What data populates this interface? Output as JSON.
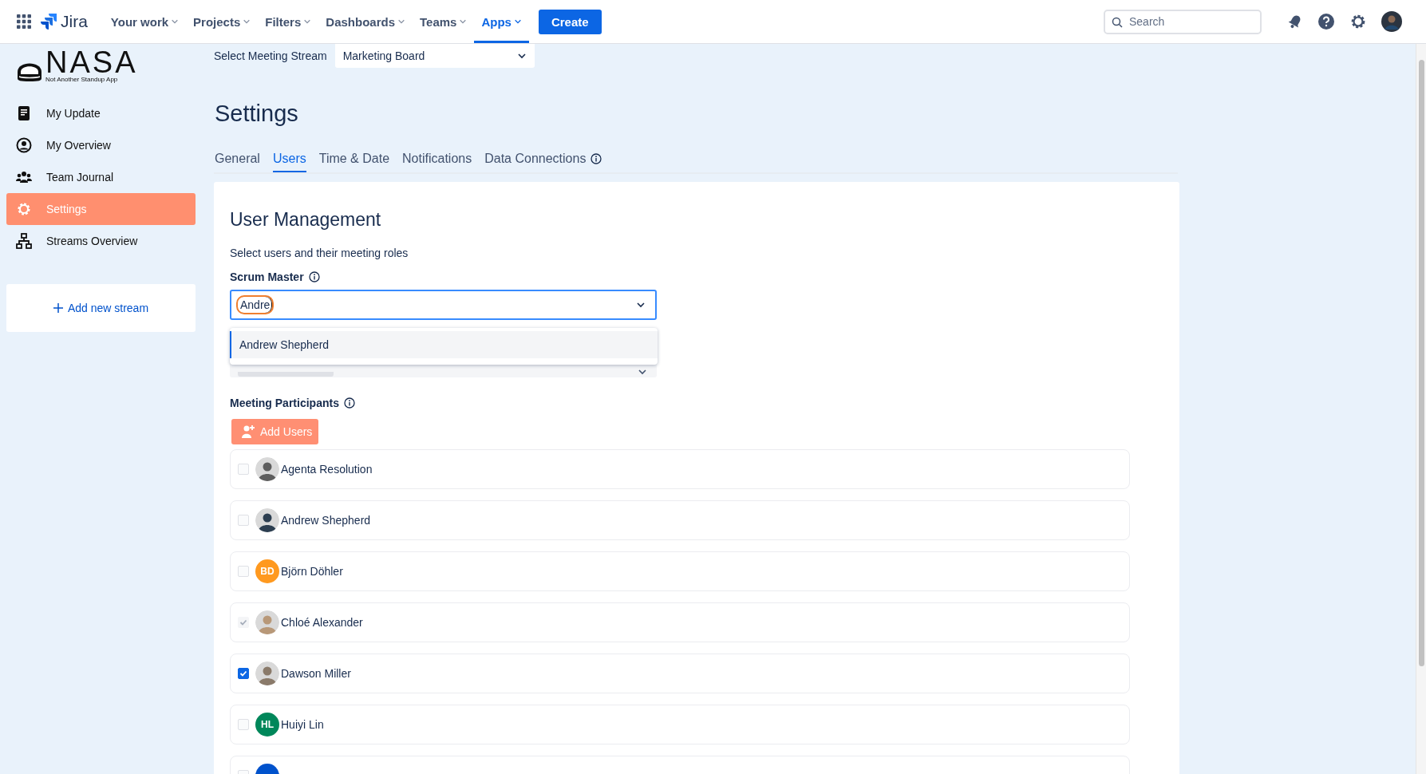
{
  "topbar": {
    "product": "Jira",
    "nav": [
      {
        "label": "Your work",
        "selected": false
      },
      {
        "label": "Projects",
        "selected": false
      },
      {
        "label": "Filters",
        "selected": false
      },
      {
        "label": "Dashboards",
        "selected": false
      },
      {
        "label": "Teams",
        "selected": false
      },
      {
        "label": "Apps",
        "selected": true
      }
    ],
    "create_button": "Create",
    "search": {
      "placeholder": "Search"
    }
  },
  "sidebar": {
    "logo": {
      "title": "NASA",
      "subtitle": "Not Another Standup App"
    },
    "items": [
      {
        "label": "My Update",
        "selected": false
      },
      {
        "label": "My Overview",
        "selected": false
      },
      {
        "label": "Team Journal",
        "selected": false
      },
      {
        "label": "Settings",
        "selected": true
      },
      {
        "label": "Streams Overview",
        "selected": false
      }
    ],
    "add_stream": "Add new stream"
  },
  "stream_select": {
    "label": "Select Meeting Stream",
    "value": "Marketing Board"
  },
  "page_title": "Settings",
  "tabs": [
    {
      "label": "General",
      "selected": false
    },
    {
      "label": "Users",
      "selected": true
    },
    {
      "label": "Time & Date",
      "selected": false
    },
    {
      "label": "Notifications",
      "selected": false
    },
    {
      "label": "Data Connections",
      "selected": false,
      "info": true
    }
  ],
  "user_management": {
    "title": "User Management",
    "description": "Select users and their meeting roles",
    "scrum_master": {
      "label": "Scrum Master",
      "value": "Andre",
      "highlighted": true,
      "options": [
        {
          "label": "Andrew Shepherd",
          "selected": true
        }
      ]
    },
    "participants_label": "Meeting Participants",
    "add_users_button": "Add Users",
    "users": [
      {
        "name": "Agenta Resolution",
        "kind": "photo",
        "color": "#5e5e5e",
        "checked": false,
        "disabled": false
      },
      {
        "name": "Andrew Shepherd",
        "kind": "photo",
        "color": "#2c3e50",
        "checked": false,
        "disabled": false
      },
      {
        "name": "Björn Döhler",
        "kind": "initials",
        "initials": "BD",
        "color": "#ff991f",
        "checked": false,
        "disabled": false
      },
      {
        "name": "Chloé Alexander",
        "kind": "photo",
        "color": "#b89878",
        "checked": true,
        "disabled": true
      },
      {
        "name": "Dawson Miller",
        "kind": "photo",
        "color": "#8a7a6a",
        "checked": true,
        "disabled": false
      },
      {
        "name": "Huiyi Lin",
        "kind": "initials",
        "initials": "HL",
        "color": "#00875a",
        "checked": false,
        "disabled": false
      },
      {
        "kind": "initials",
        "color": "#0052cc",
        "checked": false,
        "disabled": false
      }
    ]
  }
}
